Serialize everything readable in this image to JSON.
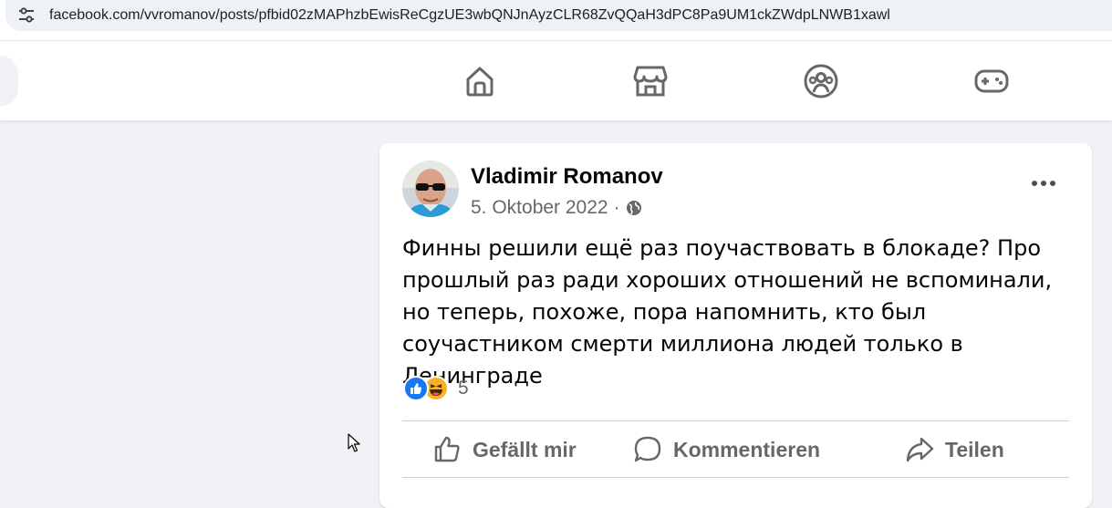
{
  "browser": {
    "url": "facebook.com/vvromanov/posts/pfbid02zMAPhzbEwisReCgzUE3wbQNJnAyzCLR68ZvQQaH3dPC8Pa9UM1ckZWdpLNWB1xawl",
    "site_info_icon": "tune-icon"
  },
  "nav": {
    "icons": [
      "home-icon",
      "marketplace-icon",
      "groups-icon",
      "gaming-icon"
    ]
  },
  "post": {
    "author": "Vladimir Romanov",
    "date": "5. Oktober 2022",
    "separator": "·",
    "audience_icon": "globe-icon",
    "text": "Финны решили ещё раз поучаствовать в блокаде? Про прошлый раз ради хороших отношений не вспоминали, но теперь, похоже, пора напомнить, кто был соучастником смерти миллиона людей только в Ленинграде",
    "reactions": {
      "types": [
        "like",
        "haha"
      ],
      "count": "5"
    },
    "actions": {
      "like": "Gefällt mir",
      "comment": "Kommentieren",
      "share": "Teilen"
    }
  },
  "colors": {
    "accent": "#1877f2",
    "text_secondary": "#65676b",
    "background": "#f0f2f5"
  }
}
